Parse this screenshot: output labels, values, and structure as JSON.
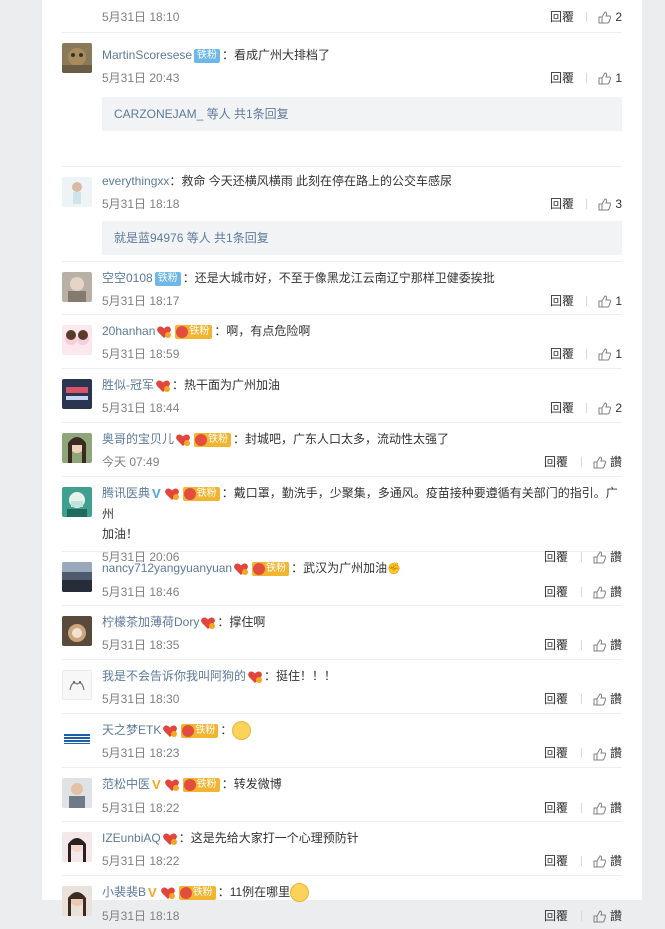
{
  "comments": [
    {
      "user": "",
      "text": "",
      "time": "5月31日 18:10",
      "reply": "回覆",
      "likes": "2"
    },
    {
      "user": "MartinScoresese",
      "badge": "铁粉",
      "text": "：看成广州大排档了",
      "time": "5月31日 20:43",
      "reply": "回覆",
      "likes": "1",
      "thread": {
        "name": "CARZONEJAM_",
        "suffix": " 等人 共1条回复"
      }
    },
    {
      "user": "everythingxx",
      "text": "：救命 今天还横风横雨 此刻在停在路上的公交车感尿",
      "time": "5月31日 18:18",
      "reply": "回覆",
      "likes": "3",
      "thread": {
        "name": "就是蓝94976",
        "suffix": " 等人 共1条回复"
      }
    },
    {
      "user": "空空0108",
      "badge": "铁粉",
      "text": "：还是大城市好，不至于像黑龙江云南辽宁那样卫健委挨批",
      "time": "5月31日 18:17",
      "reply": "回覆",
      "likes": "1"
    },
    {
      "user": "20hanhan",
      "badge": "铁粉",
      "text": "：啊，有点危险啊",
      "time": "5月31日 18:59",
      "reply": "回覆",
      "likes": "1"
    },
    {
      "user": "胜似-冠军",
      "text": "：热干面为广州加油",
      "time": "5月31日 18:44",
      "reply": "回覆",
      "likes": "2"
    },
    {
      "user": "奥哥的宝贝儿",
      "badge": "铁粉",
      "text": "：封城吧，广东人口太多，流动性太强了",
      "time": "今天 07:49",
      "reply": "回覆",
      "likes": "讚"
    },
    {
      "user": "腾讯医典",
      "badge": "铁粉",
      "text": "：戴口罩，勤洗手，少聚集，多通风。疫苗接种要遵循有关部门的指引。广州",
      "text2": "加油！",
      "time": "5月31日 20:06",
      "reply": "回覆",
      "likes": "讚"
    },
    {
      "user": "nancy712yangyuanyuan",
      "badge": "铁粉",
      "text": "：武汉为广州加油",
      "time": "5月31日 18:46",
      "reply": "回覆",
      "likes": "讚"
    },
    {
      "user": "柠檬茶加薄荷Dory",
      "text": "：撑住啊",
      "time": "5月31日 18:35",
      "reply": "回覆",
      "likes": "讚"
    },
    {
      "user": "我是不会告诉你我叫阿狗的",
      "text": "：挺住！！！",
      "time": "5月31日 18:30",
      "reply": "回覆",
      "likes": "讚"
    },
    {
      "user": "天之梦ETK",
      "badge": "铁粉",
      "text": "：",
      "time": "5月31日 18:23",
      "reply": "回覆",
      "likes": "讚"
    },
    {
      "user": "范松中医",
      "badge": "铁粉",
      "text": "：转发微博",
      "time": "5月31日 18:22",
      "reply": "回覆",
      "likes": "讚"
    },
    {
      "user": "IZEunbiAQ",
      "text": "：这是先给大家打一个心理预防针",
      "time": "5月31日 18:22",
      "reply": "回覆",
      "likes": "讚"
    },
    {
      "user": "小裴裴B",
      "badge": "铁粉",
      "text": "：11例在哪里",
      "time": "5月31日 18:18",
      "reply": "回覆",
      "likes": "讚"
    }
  ],
  "colors": {
    "name_link": "#5d7a9b",
    "gold_badge": "#f2b531",
    "blue_badge": "#6eb7e8"
  }
}
